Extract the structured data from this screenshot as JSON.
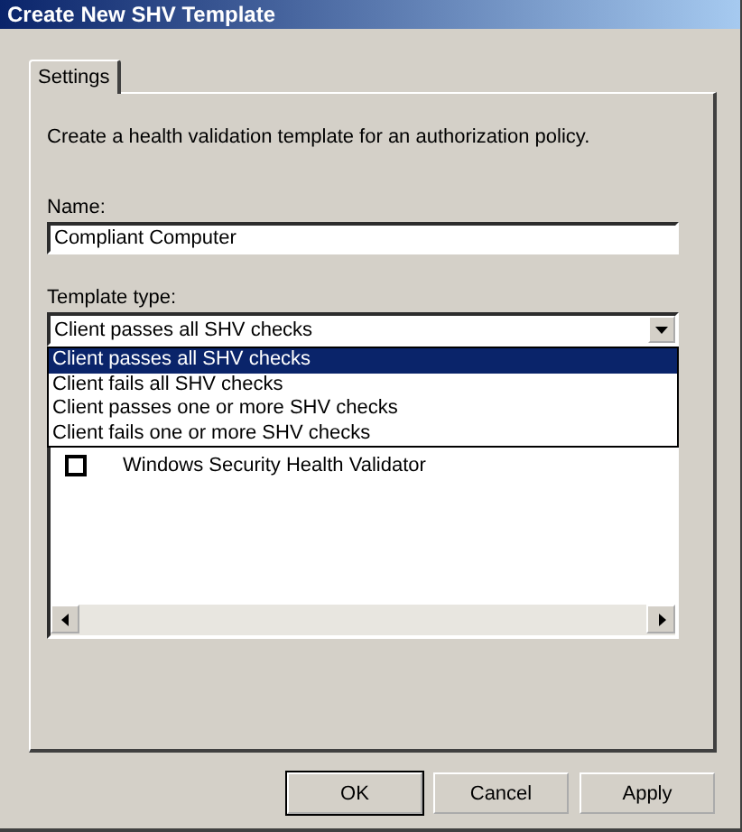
{
  "window": {
    "title": "Create New SHV Template"
  },
  "tabs": [
    {
      "label": "Settings",
      "selected": true
    }
  ],
  "description": "Create a health validation template for an authorization policy.",
  "name_field": {
    "label": "Name:",
    "value": "Compliant Computer"
  },
  "template_type": {
    "label": "Template type:",
    "value": "Client passes all SHV checks",
    "expanded": true,
    "options": [
      {
        "label": "Client passes all SHV checks",
        "selected": true
      },
      {
        "label": "Client fails all SHV checks",
        "selected": false
      },
      {
        "label": "Client passes one or more SHV checks",
        "selected": false
      },
      {
        "label": "Client fails one or more SHV checks",
        "selected": false
      }
    ]
  },
  "validators": [
    {
      "label": "Windows Security Health Validator",
      "checked": false
    }
  ],
  "buttons": [
    {
      "label": "OK",
      "kind": "default"
    },
    {
      "label": "Cancel",
      "kind": "normal"
    },
    {
      "label": "Apply",
      "kind": "normal"
    }
  ]
}
